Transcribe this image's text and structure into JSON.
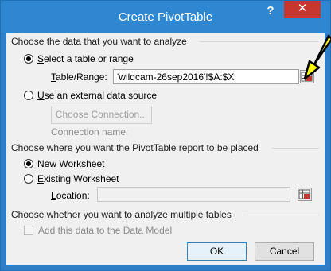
{
  "window": {
    "title": "Create PivotTable",
    "help_label": "?",
    "close_label": "✕"
  },
  "section1": {
    "label": "Choose the data that you want to analyze",
    "option_table": {
      "prefix": "S",
      "rest": "elect a table or range",
      "checked": true
    },
    "table_range_label": {
      "prefix": "T",
      "rest": "able/Range:"
    },
    "table_range_value": "'wildcam-26sep2016'!$A:$X",
    "option_external": {
      "prefix": "U",
      "rest": "se an external data source",
      "checked": false
    },
    "choose_connection_label": "Choose Connection...",
    "connection_name_label": "Connection name:"
  },
  "section2": {
    "label": "Choose where you want the PivotTable report to be placed",
    "option_new": {
      "prefix": "N",
      "rest": "ew Worksheet",
      "checked": true
    },
    "option_existing": {
      "prefix": "E",
      "rest": "xisting Worksheet",
      "checked": false
    },
    "location_label": {
      "prefix": "L",
      "rest": "ocation:"
    },
    "location_value": ""
  },
  "section3": {
    "label": "Choose whether you want to analyze multiple tables",
    "checkbox_label": "Add this data to the Data Model"
  },
  "buttons": {
    "ok": "OK",
    "cancel": "Cancel"
  },
  "icons": {
    "range_selector": "range-selector-icon",
    "annotation_arrow": "yellow-arrow-icon"
  },
  "colors": {
    "titlebar": "#2f87d1",
    "close": "#c7372f",
    "arrow_fill": "#ffff00"
  }
}
